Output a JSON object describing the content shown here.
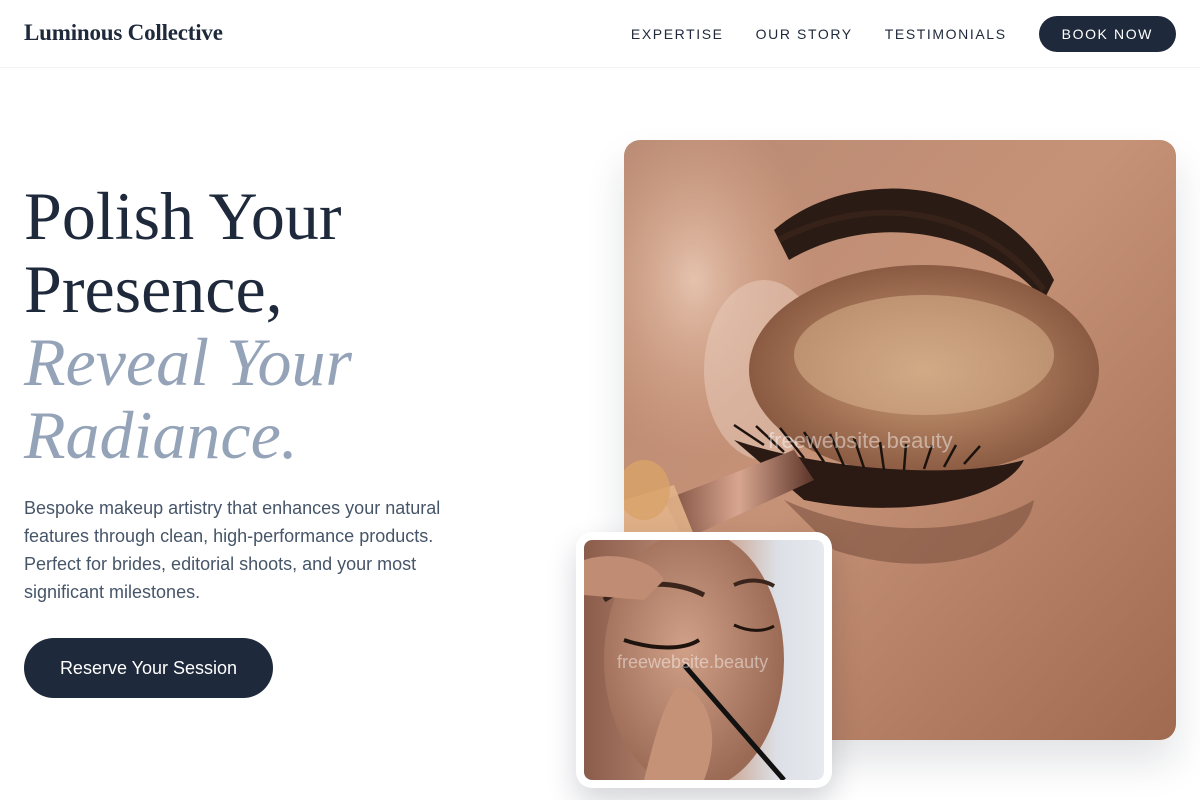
{
  "brand": {
    "name": "Luminous Collective"
  },
  "nav": {
    "links": [
      {
        "label": "EXPERTISE"
      },
      {
        "label": "OUR STORY"
      },
      {
        "label": "TESTIMONIALS"
      }
    ],
    "cta_label": "BOOK NOW"
  },
  "hero": {
    "title_line1": "Polish Your",
    "title_line2": "Presence,",
    "accent_line1": "Reveal Your",
    "accent_line2": "Radiance.",
    "description": "Bespoke makeup artistry that enhances your natural features through clean, high-performance products. Perfect for brides, editorial shoots, and your most significant milestones.",
    "cta_label": "Reserve Your Session"
  },
  "images": {
    "main_watermark": "freewebsite.beauty",
    "inset_watermark": "freewebsite.beauty"
  },
  "colors": {
    "primary": "#1e293b",
    "accent_text": "#94a3b8",
    "body_text": "#475569"
  }
}
